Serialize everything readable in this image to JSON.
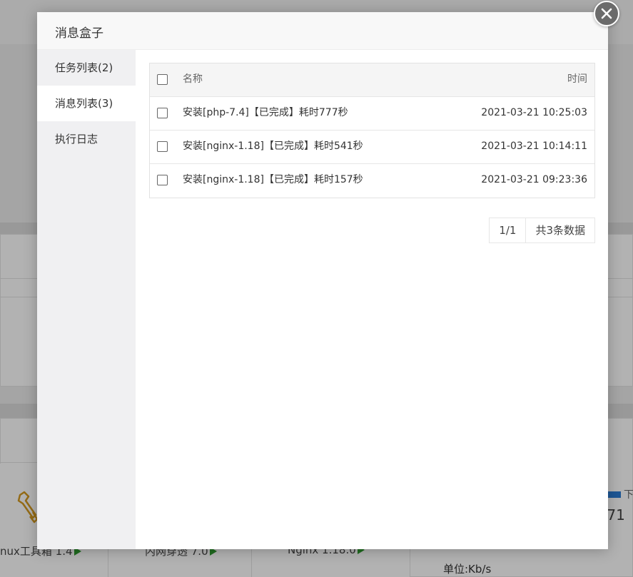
{
  "modal": {
    "title": "消息盒子",
    "close_icon": "close-icon"
  },
  "sidebar": {
    "items": [
      {
        "label": "任务列表(2)",
        "active": false
      },
      {
        "label": "消息列表(3)",
        "active": true
      },
      {
        "label": "执行日志",
        "active": false
      }
    ]
  },
  "table": {
    "headers": {
      "name": "名称",
      "time": "时间"
    },
    "rows": [
      {
        "name": "安装[php-7.4]【已完成】耗时777秒",
        "time": "2021-03-21 10:25:03"
      },
      {
        "name": "安装[nginx-1.18]【已完成】耗时541秒",
        "time": "2021-03-21 10:14:11"
      },
      {
        "name": "安装[nginx-1.18]【已完成】耗时157秒",
        "time": "2021-03-21 09:23:36"
      }
    ]
  },
  "pagination": {
    "page": "1/1",
    "total": "共3条数据"
  },
  "background": {
    "software": [
      {
        "label": "nux工具箱 1.4"
      },
      {
        "label": "内网穿透 7.0"
      },
      {
        "label": "Nginx 1.18.0"
      }
    ],
    "legend_label": "下",
    "net_value": ".71",
    "unit": "单位:Kb/s",
    "legend_color": "#2a7bd4",
    "play_color": "#2e9b2e"
  }
}
